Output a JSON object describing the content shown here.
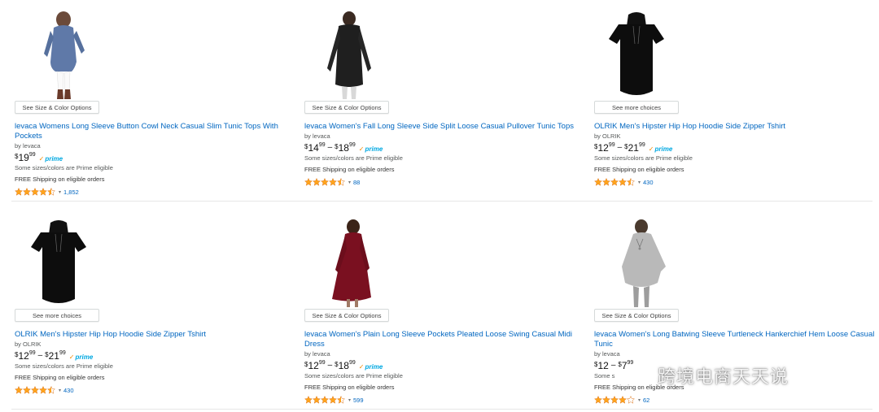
{
  "products": [
    {
      "option_button": "See Size & Color Options",
      "title": "levaca Womens Long Sleeve Button Cowl Neck Casual Slim Tunic Tops With Pockets",
      "byline": "by levaca",
      "price_whole": "19",
      "price_frac": "99",
      "price_max_whole": "",
      "price_max_frac": "",
      "prime": "prime",
      "eligible_note": "Some sizes/colors are Prime eligible",
      "shipping": "FREE Shipping on eligible orders",
      "rating": 4.5,
      "review_count": "1,852",
      "image": "blue-cowl-neck-tunic"
    },
    {
      "option_button": "See Size & Color Options",
      "title": "levaca Women's Fall Long Sleeve Side Split Loose Casual Pullover Tunic Tops",
      "byline": "by levaca",
      "price_whole": "14",
      "price_frac": "99",
      "price_max_whole": "18",
      "price_max_frac": "99",
      "prime": "prime",
      "eligible_note": "Some sizes/colors are Prime eligible",
      "shipping": "FREE Shipping on eligible orders",
      "rating": 4.5,
      "review_count": "88",
      "image": "black-long-sleeve-tunic"
    },
    {
      "option_button": "See more choices",
      "title": "OLRIK Men's Hipster Hip Hop Hoodie Side Zipper Tshirt",
      "byline": "by OLRIK",
      "price_whole": "12",
      "price_frac": "99",
      "price_max_whole": "21",
      "price_max_frac": "99",
      "prime": "prime",
      "eligible_note": "Some sizes/colors are Prime eligible",
      "shipping": "FREE Shipping on eligible orders",
      "rating": 4.5,
      "review_count": "430",
      "image": "black-hooded-tshirt"
    },
    {
      "option_button": "See more choices",
      "title": "OLRIK Men's Hipster Hip Hop Hoodie Side Zipper Tshirt",
      "byline": "by OLRIK",
      "price_whole": "12",
      "price_frac": "99",
      "price_max_whole": "21",
      "price_max_frac": "99",
      "prime": "prime",
      "eligible_note": "Some sizes/colors are Prime eligible",
      "shipping": "FREE Shipping on eligible orders",
      "rating": 4.5,
      "review_count": "430",
      "image": "black-hooded-tshirt"
    },
    {
      "option_button": "See Size & Color Options",
      "title": "levaca Women's Plain Long Sleeve Pockets Pleated Loose Swing Casual Midi Dress",
      "byline": "by levaca",
      "price_whole": "12",
      "price_frac": "99",
      "price_max_whole": "18",
      "price_max_frac": "99",
      "prime": "prime",
      "eligible_note": "Some sizes/colors are Prime eligible",
      "shipping": "FREE Shipping on eligible orders",
      "rating": 4.5,
      "review_count": "599",
      "image": "burgundy-midi-dress"
    },
    {
      "option_button": "See Size & Color Options",
      "title": "levaca Women's Long Batwing Sleeve Turtleneck Hankerchief Hem Loose Casual Tunic",
      "byline": "by levaca",
      "price_whole": "12",
      "price_frac": "",
      "price_max_whole": "7",
      "price_max_frac": "99",
      "prime": "",
      "eligible_note": "Some s",
      "shipping": "FREE Shipping on eligible orders",
      "rating": 4,
      "review_count": "62",
      "image": "grey-batwing-tunic"
    }
  ],
  "colors": {
    "link": "#0066c0",
    "star": "#ffa41c",
    "prime_blue": "#00a8e1",
    "prime_check": "#f08804"
  },
  "watermark": {
    "text": "跨境电商天天说",
    "icon": "wechat-icon"
  }
}
